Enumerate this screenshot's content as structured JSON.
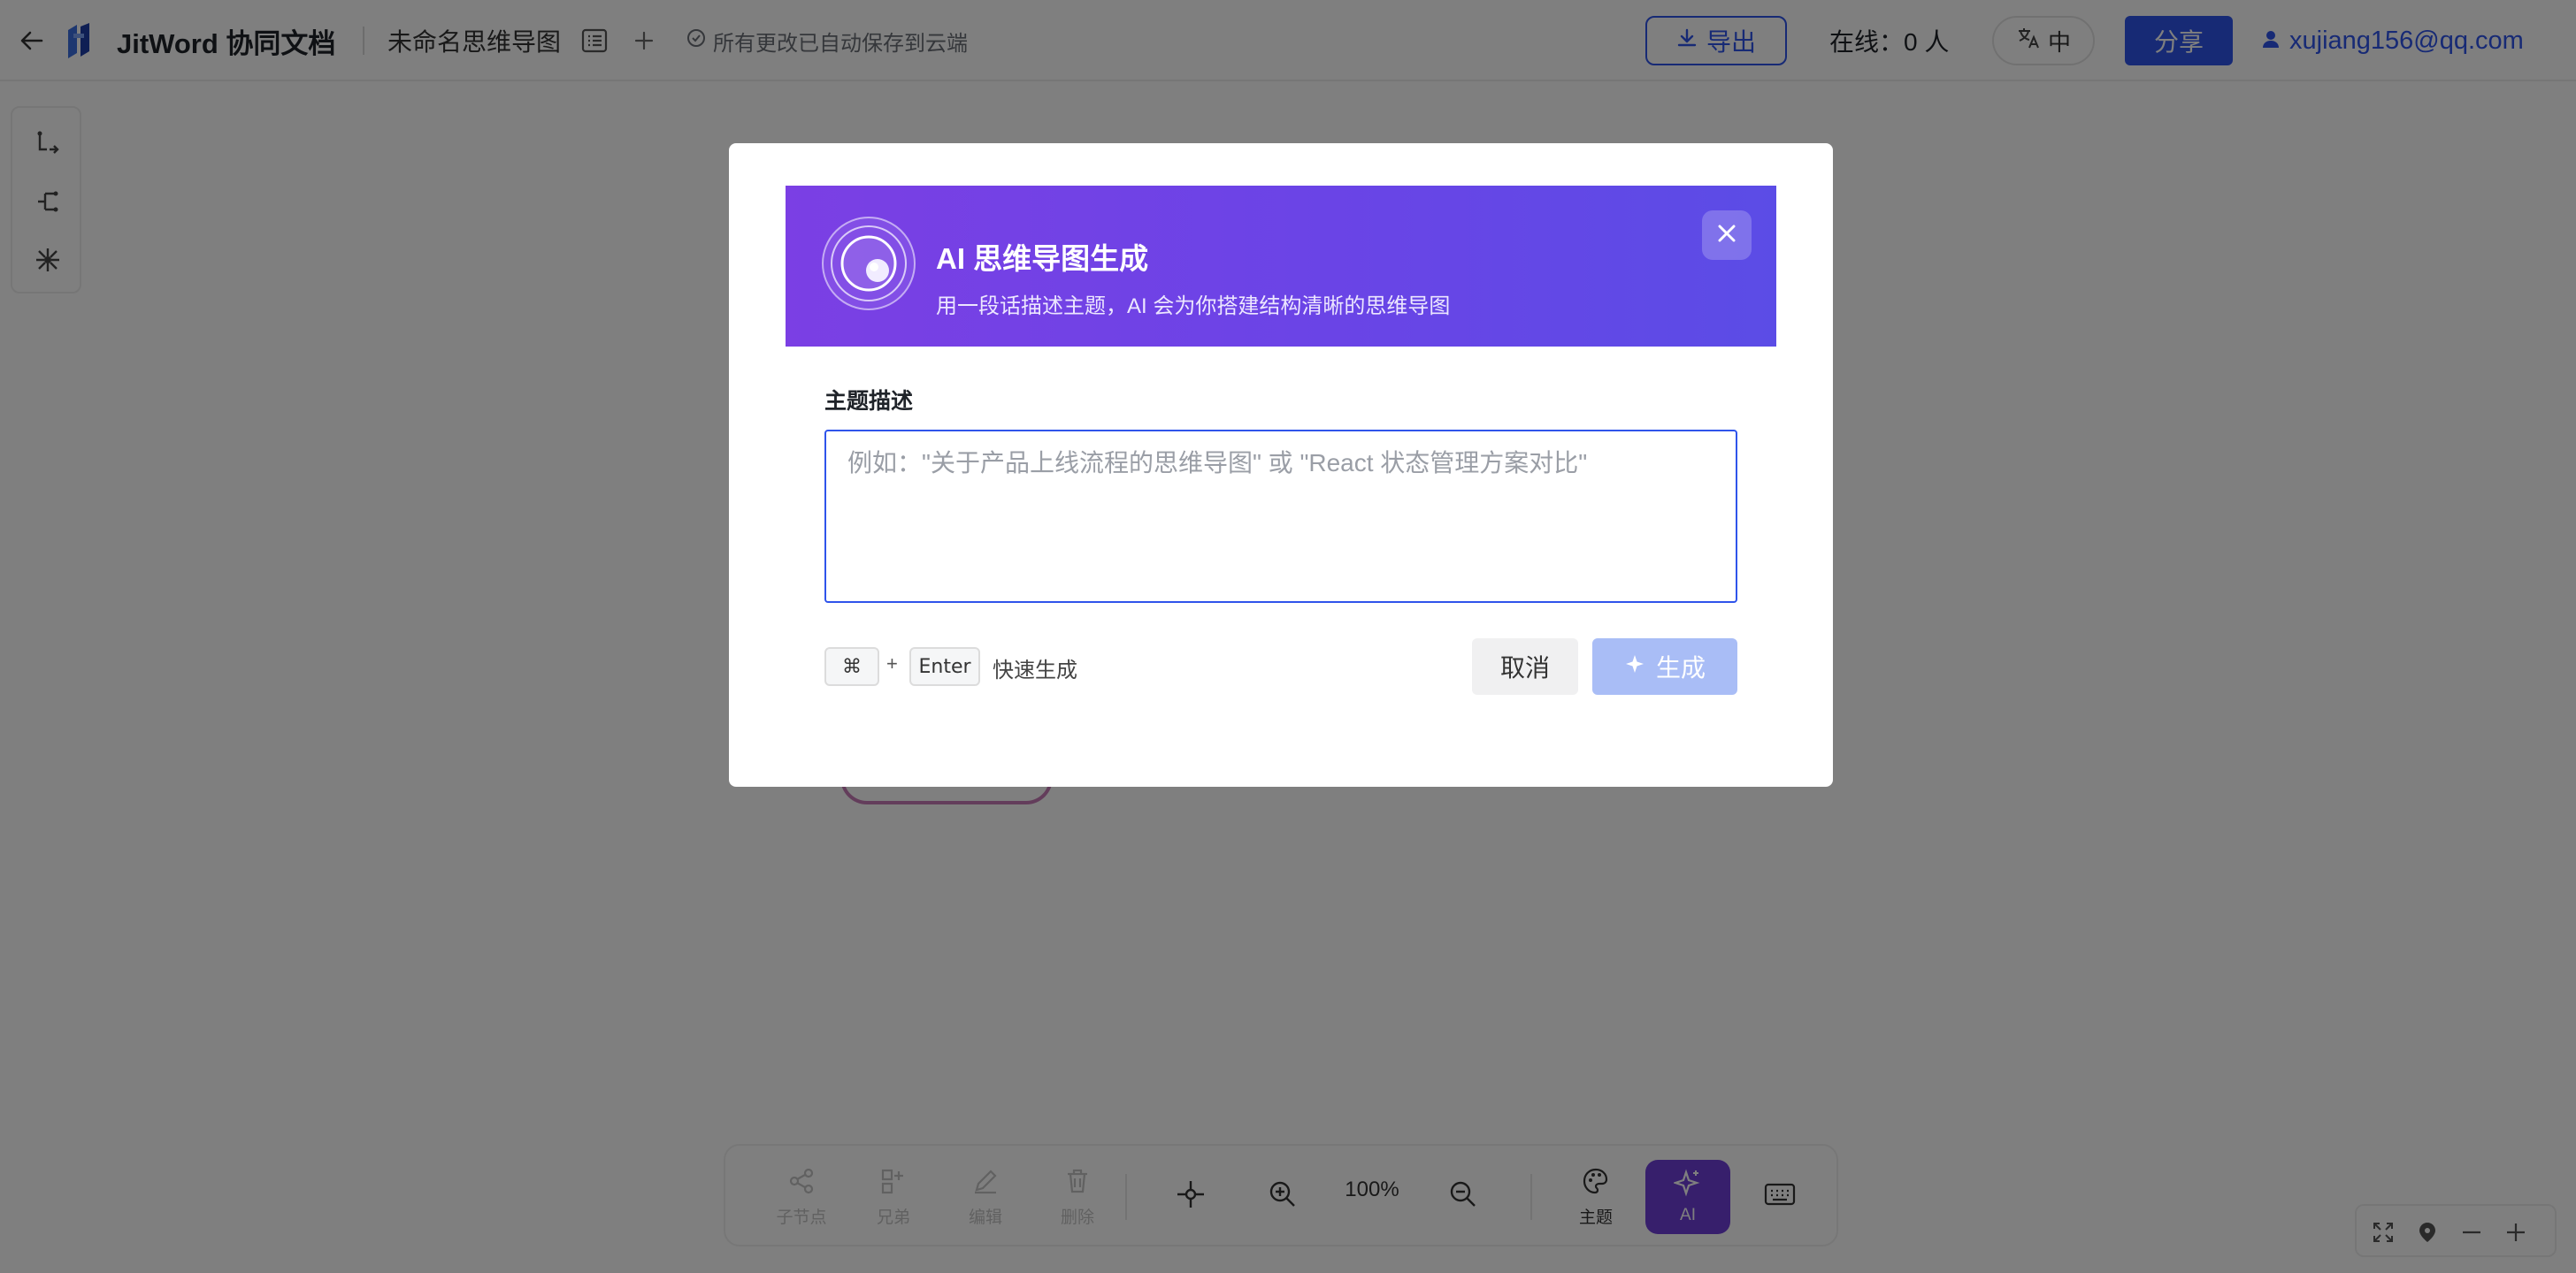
{
  "topbar": {
    "brand": "JitWord 协同文档",
    "doc_title": "未命名思维导图",
    "save_status": "所有更改已自动保存到云端",
    "export_label": "导出",
    "online_text": "在线：0 人",
    "lang_label": "中",
    "share_label": "分享",
    "user_email": "xujiang156@qq.com"
  },
  "left_tools": {
    "icons": [
      "child-node-layout-icon",
      "sibling-node-layout-icon",
      "radial-layout-icon"
    ]
  },
  "bottom_toolbar": {
    "child_node_label": "子节点",
    "sibling_label": "兄弟",
    "edit_label": "编辑",
    "delete_label": "删除",
    "zoom_level": "100%",
    "theme_label": "主题",
    "ai_label": "AI"
  },
  "modal": {
    "title": "AI 思维导图生成",
    "subtitle": "用一段话描述主题，AI 会为你搭建结构清晰的思维导图",
    "field_label": "主题描述",
    "input_value": "",
    "input_placeholder": "例如：\"关于产品上线流程的思维导图\" 或 \"React 状态管理方案对比\"",
    "shortcut_key_1": "⌘",
    "shortcut_plus": "+",
    "shortcut_key_2": "Enter",
    "shortcut_text": "快速生成",
    "cancel_label": "取消",
    "generate_label": "生成"
  },
  "colors": {
    "accent": "#2f54eb",
    "header_gradient_start": "#7b3fe4",
    "header_gradient_end": "#5b4ce6",
    "generate_disabled": "#a9bdf6",
    "ai_button": "#6f3fd9"
  }
}
